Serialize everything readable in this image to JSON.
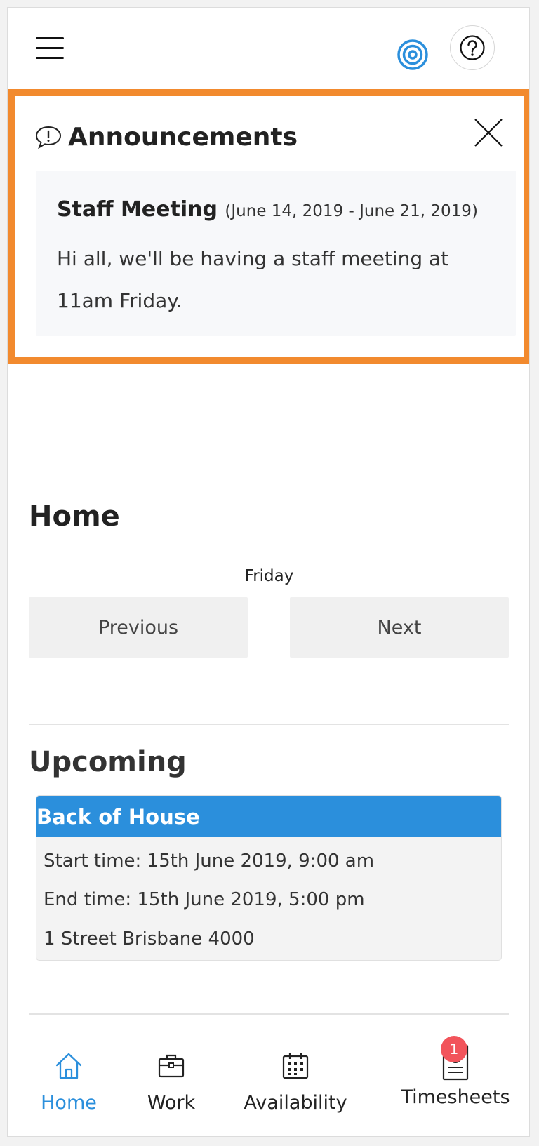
{
  "header": {
    "menu_icon": "hamburger-menu-icon",
    "brand_icon": "target-logo-icon",
    "help_icon": "question-mark-icon",
    "accent_color": "#2b8fdc"
  },
  "announcements": {
    "title": "Announcements",
    "icon": "speech-bubble-alert-icon",
    "close_icon": "close-icon",
    "highlight_color": "#f28a2e",
    "items": [
      {
        "title": "Staff Meeting",
        "dates": "(June 14, 2019 - June 21, 2019)",
        "body": "Hi all, we'll be having a staff meeting at 11am Friday."
      }
    ]
  },
  "home": {
    "title": "Home",
    "day": "Friday",
    "previous_label": "Previous",
    "next_label": "Next"
  },
  "upcoming": {
    "title": "Upcoming",
    "shifts": [
      {
        "area": "Back of House",
        "start": "Start time: 15th June 2019, 9:00 am",
        "end": "End time: 15th June 2019, 5:00 pm",
        "address": "1 Street Brisbane 4000"
      }
    ]
  },
  "bottom_nav": {
    "items": [
      {
        "label": "Home",
        "icon": "home-icon",
        "active": true
      },
      {
        "label": "Work",
        "icon": "briefcase-icon",
        "active": false
      },
      {
        "label": "Availability",
        "icon": "calendar-icon",
        "active": false
      },
      {
        "label": "Timesheets",
        "icon": "timesheet-clock-icon",
        "active": false,
        "badge": "1"
      }
    ],
    "badge_color": "#f2545b"
  }
}
